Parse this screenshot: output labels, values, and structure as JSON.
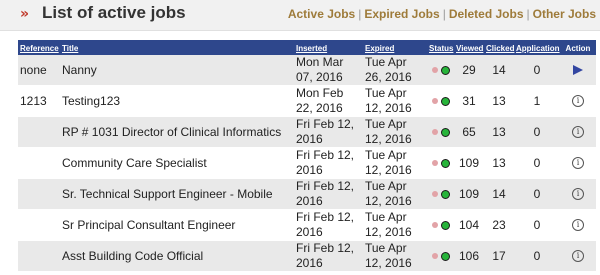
{
  "header": {
    "title": "List of active jobs",
    "links": [
      "Active Jobs",
      "Expired Jobs",
      "Deleted Jobs",
      "Other Jobs"
    ]
  },
  "table": {
    "columns": [
      "Reference",
      "Title",
      "Inserted",
      "Expired",
      "Status",
      "Viewed",
      "Clicked",
      "Application",
      "Action"
    ],
    "rows": [
      {
        "reference": "none",
        "title": "Nanny",
        "inserted": "Mon Mar 07, 2016",
        "expired": "Tue Apr 26, 2016",
        "viewed": "29",
        "clicked": "14",
        "application": "0",
        "action": "play-icon"
      },
      {
        "reference": "1213",
        "title": "Testing123",
        "inserted": "Mon Feb 22, 2016",
        "expired": "Tue Apr 12, 2016",
        "viewed": "31",
        "clicked": "13",
        "application": "1",
        "action": "info-icon"
      },
      {
        "reference": "",
        "title": "RP # 1031 Director of Clinical Informatics",
        "inserted": "Fri Feb 12, 2016",
        "expired": "Tue Apr 12, 2016",
        "viewed": "65",
        "clicked": "13",
        "application": "0",
        "action": "info-icon"
      },
      {
        "reference": "",
        "title": "Community Care Specialist",
        "inserted": "Fri Feb 12, 2016",
        "expired": "Tue Apr 12, 2016",
        "viewed": "109",
        "clicked": "13",
        "application": "0",
        "action": "info-icon"
      },
      {
        "reference": "",
        "title": "Sr. Technical Support Engineer - Mobile",
        "inserted": "Fri Feb 12, 2016",
        "expired": "Tue Apr 12, 2016",
        "viewed": "109",
        "clicked": "14",
        "application": "0",
        "action": "info-icon"
      },
      {
        "reference": "",
        "title": "Sr Principal Consultant Engineer",
        "inserted": "Fri Feb 12, 2016",
        "expired": "Tue Apr 12, 2016",
        "viewed": "104",
        "clicked": "23",
        "application": "0",
        "action": "info-icon"
      },
      {
        "reference": "",
        "title": "Asst Building Code Official",
        "inserted": "Fri Feb 12, 2016",
        "expired": "Tue Apr 12, 2016",
        "viewed": "106",
        "clicked": "17",
        "application": "0",
        "action": "info-icon"
      }
    ]
  },
  "colors": {
    "header_bg": "#2e478c",
    "row_alt": "#e9e9e9",
    "accent": "#c0392b",
    "link": "#9e7b3a"
  }
}
